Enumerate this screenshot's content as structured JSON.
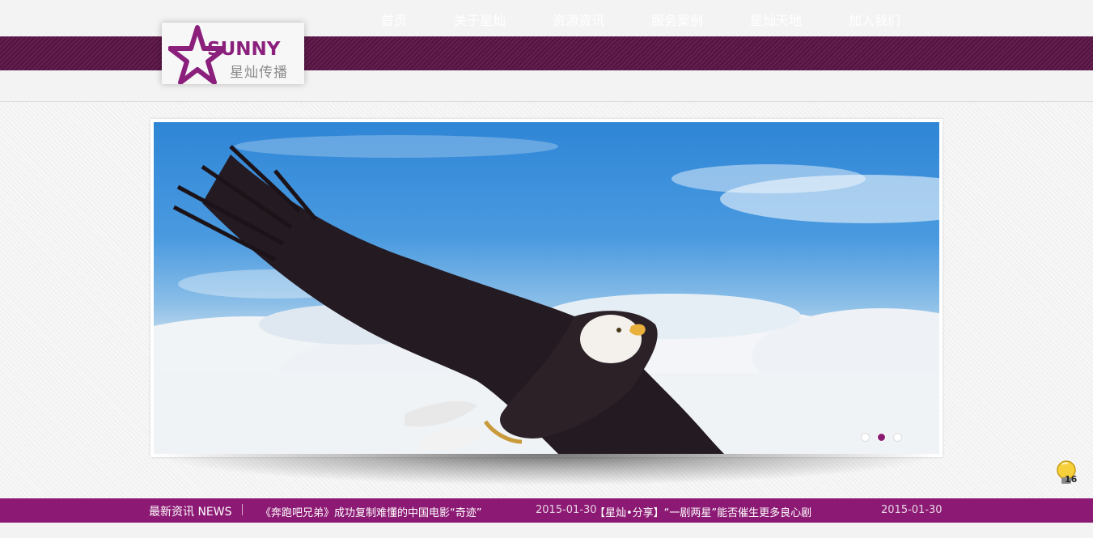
{
  "brand": {
    "logo_en": "SUNNY",
    "logo_cn": "星灿传播",
    "primary_color": "#5a1446",
    "accent_color": "#8c1a74"
  },
  "nav": {
    "items": [
      {
        "label": "首页"
      },
      {
        "label": "关于星灿"
      },
      {
        "label": "资源资讯"
      },
      {
        "label": "服务案例"
      },
      {
        "label": "星灿天地"
      },
      {
        "label": "加入我们"
      }
    ]
  },
  "slider": {
    "image_subject": "bald-eagle-above-clouds",
    "dot_count": 3,
    "active_dot": 2
  },
  "news": {
    "title": "最新资讯 NEWS",
    "items": [
      {
        "text": "《奔跑吧兄弟》成功复制难懂的中国电影“奇迹”",
        "date": "2015-01-30"
      },
      {
        "text": "【星灿•分享】“一剧两星”能否催生更多良心剧",
        "date": "2015-01-30"
      }
    ]
  },
  "widget": {
    "icon": "lightbulb-icon",
    "count": "16"
  }
}
